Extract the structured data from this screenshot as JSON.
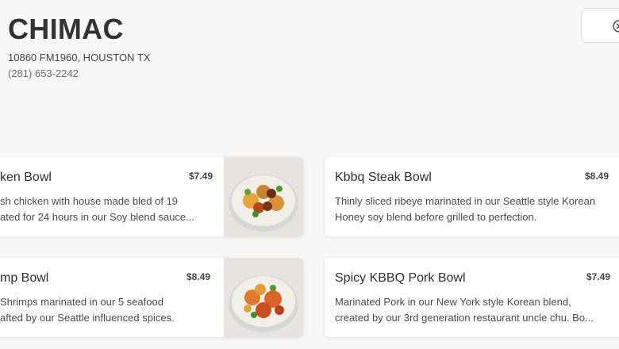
{
  "restaurant": {
    "name": "CHIMAC",
    "address": "10860 FM1960, HOUSTON TX",
    "phone": "(281) 653-2242"
  },
  "menu_items": [
    {
      "title": "ken Bowl",
      "price": "$7.49",
      "desc_line1": "sh chicken with house made bled of 19",
      "desc_line2": "ated for 24 hours in our Soy blend sauce..."
    },
    {
      "title": "Kbbq Steak Bowl",
      "price": "$8.49",
      "desc_line1": "Thinly sliced ribeye marinated in our Seattle style Korean",
      "desc_line2": "Honey soy blend before grilled to perfection."
    },
    {
      "title": "mp Bowl",
      "price": "$8.49",
      "desc_line1": "Shrimps marinated in our 5 seafood",
      "desc_line2": "afted by our Seattle influenced spices."
    },
    {
      "title": "Spicy KBBQ Pork Bowl",
      "price": "$7.49",
      "desc_line1": "Marinated Pork in our New York style Korean blend,",
      "desc_line2": "created by our 3rd generation restaurant uncle chu. Bo..."
    }
  ],
  "icons": {
    "top_right": "close-icon",
    "thumb": "food-bowl-image"
  }
}
